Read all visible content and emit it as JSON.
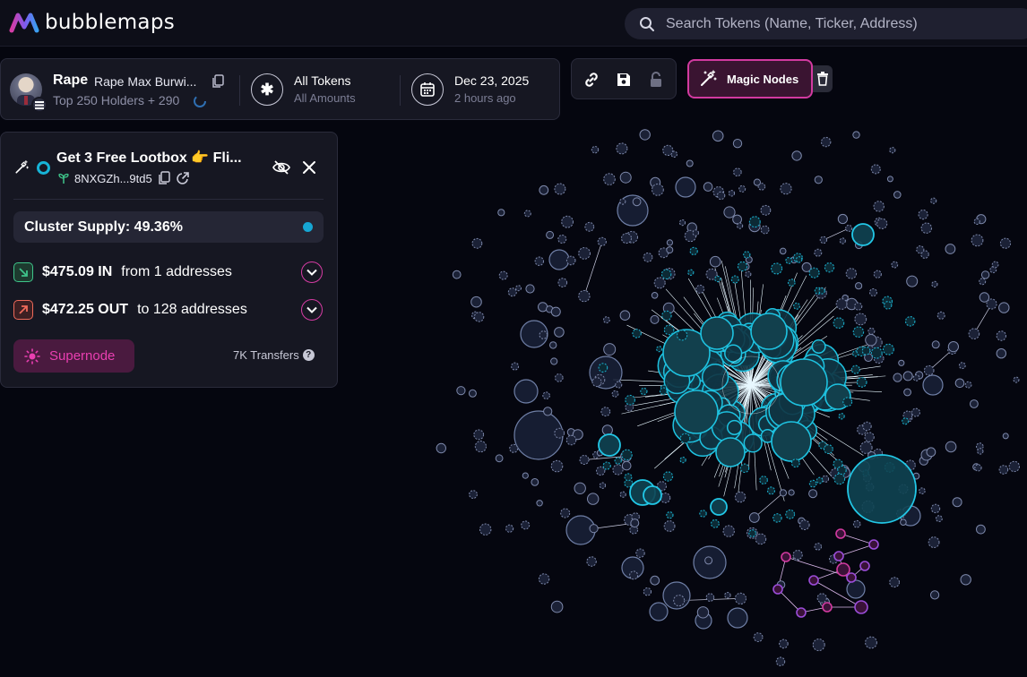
{
  "app": {
    "name": "bubblemaps"
  },
  "search": {
    "placeholder": "Search Tokens (Name, Ticker, Address)"
  },
  "token": {
    "ticker": "Rape",
    "name": "Rape Max Burwi...",
    "holders_summary": "Top 250 Holders + 290"
  },
  "filter": {
    "title": "All Tokens",
    "subtitle": "All Amounts"
  },
  "date": {
    "title": "Dec 23, 2025",
    "subtitle": "2 hours ago"
  },
  "actions": {
    "magic_nodes_label": "Magic Nodes"
  },
  "cluster_panel": {
    "title": "Get 3 Free Lootbox 👉 Fli...",
    "address": "8NXGZh...9td5",
    "cluster_supply": "Cluster Supply: 49.36%",
    "inflow": {
      "amount": "$475.09 IN",
      "detail": "from 1 addresses"
    },
    "outflow": {
      "amount": "$472.25 OUT",
      "detail": "to 128 addresses"
    },
    "supernode_label": "Supernode",
    "transfers": "7K Transfers"
  },
  "colors": {
    "accent_pink": "#d23aa0",
    "cluster_cyan": "#17b3d6",
    "inflow_green": "#3ec48a",
    "outflow_red": "#ef6a5a",
    "background": "#05060f"
  },
  "icons": [
    "logo-icon",
    "search-icon",
    "copy-icon",
    "solana-icon",
    "spinner-icon",
    "asterisk-icon",
    "calendar-icon",
    "link-icon",
    "save-icon",
    "lock-icon",
    "magic-wand-icon",
    "trash-icon",
    "eye-off-icon",
    "close-icon",
    "sprout-icon",
    "external-link-icon",
    "arrow-in-icon",
    "arrow-out-icon",
    "chevron-down-icon",
    "sun-icon",
    "help-icon"
  ]
}
